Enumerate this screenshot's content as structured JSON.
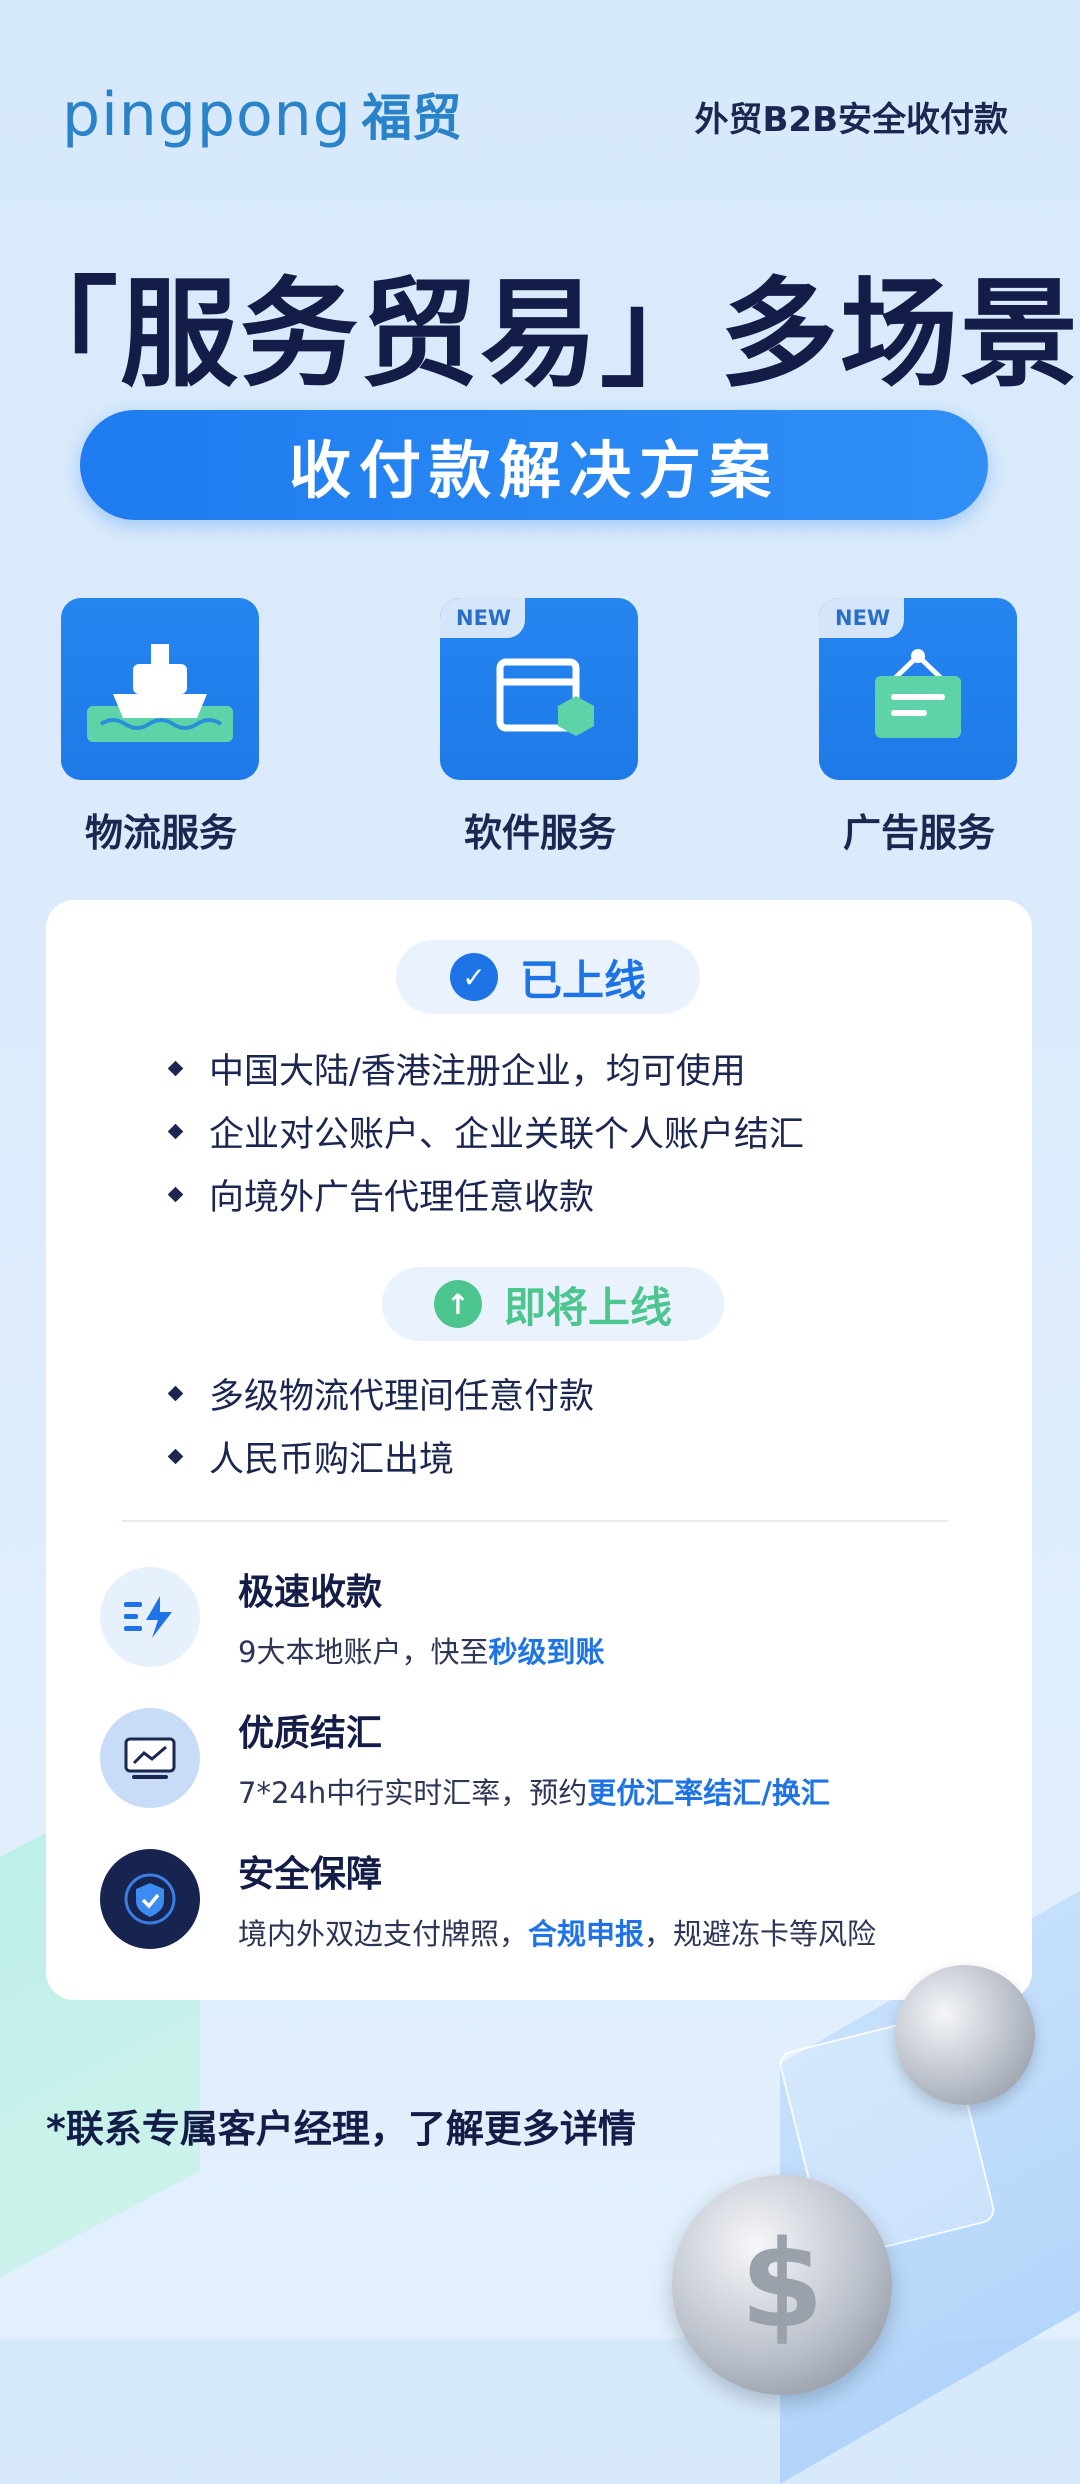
{
  "header": {
    "logo_en": "pingpong",
    "logo_cn": "福贸",
    "tagline": "外贸B2B安全收付款"
  },
  "headline": "「服务贸易」多场景",
  "subtitle": "收付款解决方案",
  "services": [
    {
      "label": "物流服务",
      "icon": "ship-icon",
      "badge": ""
    },
    {
      "label": "软件服务",
      "icon": "software-window-icon",
      "badge": "NEW"
    },
    {
      "label": "广告服务",
      "icon": "billboard-icon",
      "badge": "NEW"
    }
  ],
  "online": {
    "title": "已上线",
    "items": [
      "中国大陆/香港注册企业，均可使用",
      "企业对公账户、企业关联个人账户结汇",
      "向境外广告代理任意收款"
    ]
  },
  "upcoming": {
    "title": "即将上线",
    "items": [
      "多级物流代理间任意付款",
      "人民币购汇出境"
    ]
  },
  "features": [
    {
      "title": "极速收款",
      "desc_pre": "9大本地账户，快至",
      "desc_hl": "秒级到账",
      "desc_post": ""
    },
    {
      "title": "优质结汇",
      "desc_pre": "7*24h中行实时汇率，预约",
      "desc_hl": "更优汇率结汇/换汇",
      "desc_post": ""
    },
    {
      "title": "安全保障",
      "desc_pre": "境内外双边支付牌照，",
      "desc_hl": "合规申报",
      "desc_post": "，规避冻卡等风险"
    }
  ],
  "footer": "*联系专属客户经理，了解更多详情",
  "colors": {
    "brand_blue": "#1f7cf0",
    "navy": "#141d48",
    "green": "#4cc58f"
  }
}
